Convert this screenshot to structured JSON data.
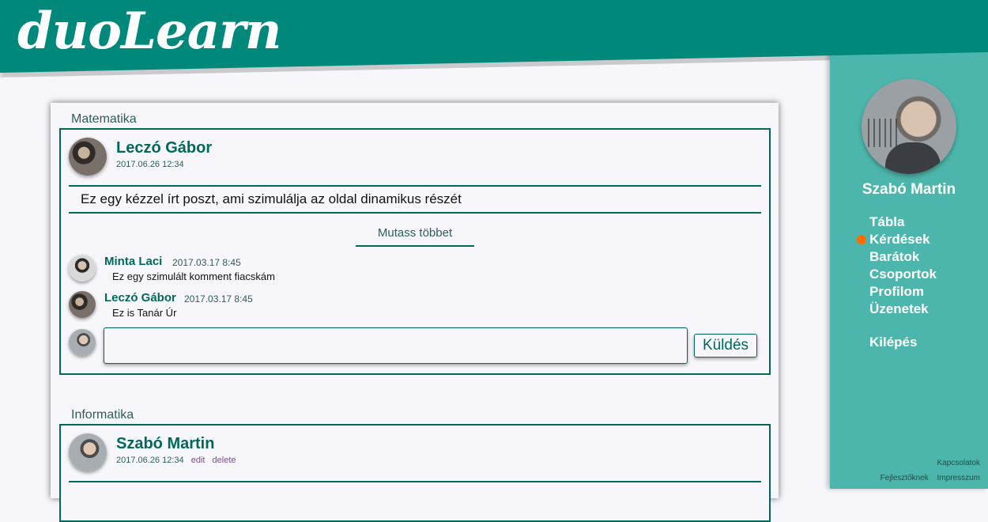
{
  "app": {
    "logo": "duoLearn"
  },
  "sidebar": {
    "user_name": "Szabó Martin",
    "menu": [
      {
        "label": "Tábla",
        "active": false
      },
      {
        "label": "Kérdések",
        "active": true
      },
      {
        "label": "Barátok",
        "active": false
      },
      {
        "label": "Csoportok",
        "active": false
      },
      {
        "label": "Profilom",
        "active": false
      },
      {
        "label": "Üzenetek",
        "active": false
      }
    ],
    "logout": "Kilépés",
    "footer": {
      "contacts": "Kapcsolatok",
      "developers": "Fejlesztőknek",
      "imprint": "Impresszum"
    }
  },
  "feed": {
    "posts": [
      {
        "subject": "Matematika",
        "author": "Leczó Gábor",
        "date": "2017.06.26 12:34",
        "text": "Ez egy kézzel írt poszt, ami szimulálja az oldal dinamikus részét",
        "show_more": "Mutass többet",
        "comments": [
          {
            "author": "Minta Laci",
            "date": "2017.03.17 8:45",
            "text": "Ez egy szimulált komment fiacskám"
          },
          {
            "author": "Leczó Gábor",
            "date": "2017.03.17 8:45",
            "text": "Ez is Tanár Úr"
          }
        ],
        "comment_input": {
          "value": "",
          "placeholder": ""
        },
        "send_label": "Küldés"
      },
      {
        "subject": "Informatika",
        "author": "Szabó Martin",
        "date": "2017.06.26 12:34",
        "edit_label": "edit",
        "delete_label": "delete"
      }
    ]
  },
  "colors": {
    "primary": "#00897b",
    "sidebar": "#4db6ac",
    "accent": "#ff6f00",
    "text_dark": "#00695c"
  }
}
